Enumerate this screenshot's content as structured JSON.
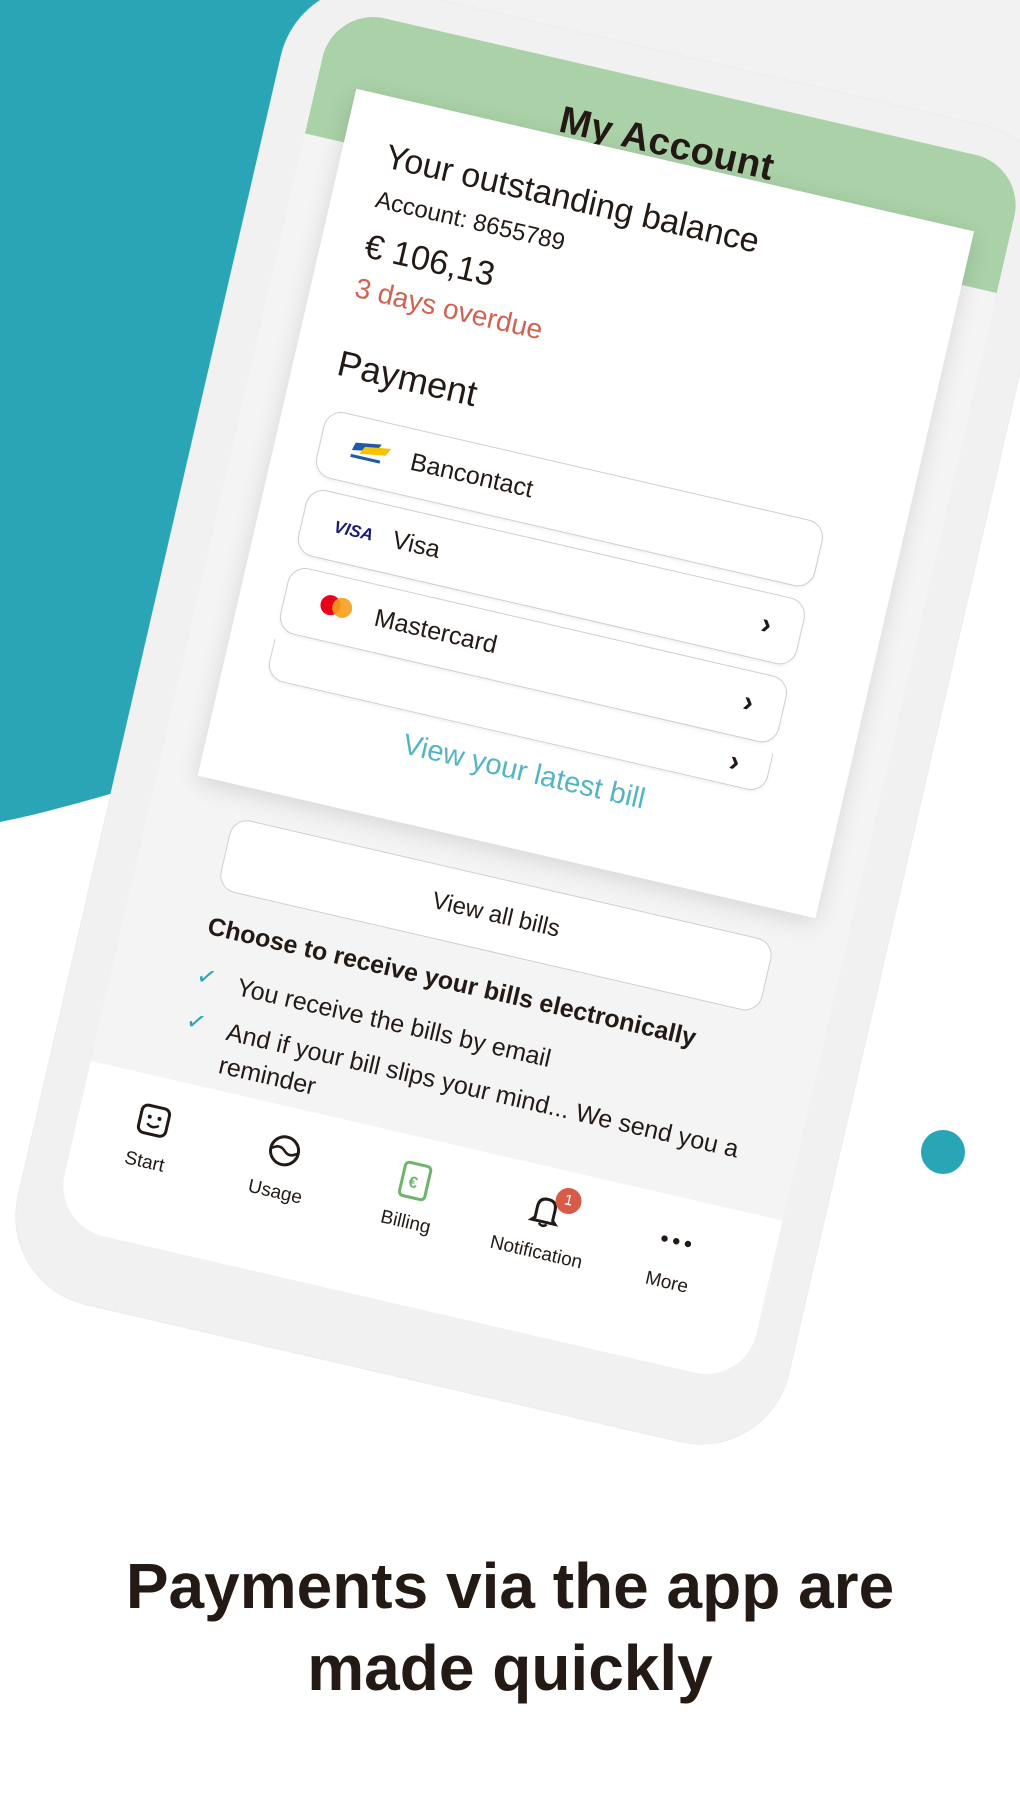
{
  "colors": {
    "teal": "#29a5b5",
    "header_green": "#aad1a8",
    "overdue_red": "#d2614f",
    "link_blue": "#55b4c4",
    "badge_red": "#d85a48"
  },
  "header": {
    "title": "My Account"
  },
  "balance": {
    "title": "Your outstanding balance",
    "account": "Account: 8655789",
    "amount": "€ 106,13",
    "status": "3 days overdue"
  },
  "payment": {
    "title": "Payment",
    "methods": [
      {
        "label": "Bancontact",
        "icon": "bancontact-logo"
      },
      {
        "label": "Visa",
        "icon": "visa-logo"
      },
      {
        "label": "Mastercard",
        "icon": "mastercard-logo"
      }
    ],
    "view_latest": "View your latest bill"
  },
  "bills": {
    "view_all": "View all bills",
    "ebills_title": "Choose to receive your bills electronically",
    "benefits": [
      "You receive the bills by email",
      "And if your bill slips your mind... We send you a reminder",
      "Payments via the app are made quickly"
    ]
  },
  "tabs": [
    {
      "label": "Start",
      "icon": "smiley-icon"
    },
    {
      "label": "Usage",
      "icon": "gauge-icon"
    },
    {
      "label": "Billing",
      "icon": "billing-icon"
    },
    {
      "label": "Notification",
      "icon": "bell-icon",
      "badge": "1"
    },
    {
      "label": "More",
      "icon": "more-icon"
    }
  ],
  "caption": {
    "line1": "Payments via the app are",
    "line2": "made quickly"
  }
}
